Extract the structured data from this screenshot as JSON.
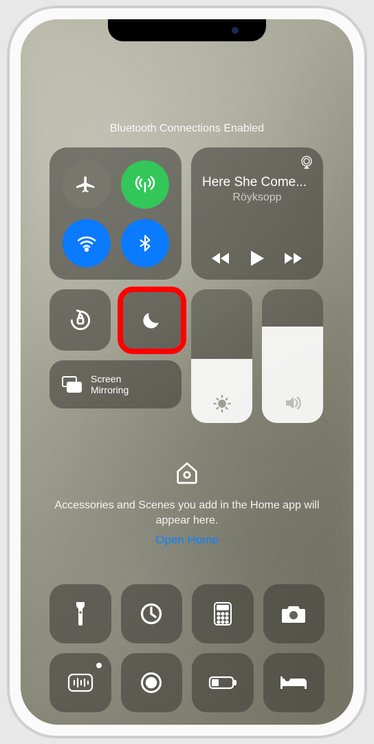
{
  "banner": "Bluetooth Connections Enabled",
  "connectivity": {
    "airplane": {
      "name": "airplane-mode",
      "active": false
    },
    "cellular": {
      "name": "cellular-data",
      "active": true
    },
    "wifi": {
      "name": "wifi",
      "active": true
    },
    "bluetooth": {
      "name": "bluetooth",
      "active": true
    }
  },
  "media": {
    "title": "Here She Come...",
    "artist": "Röyksopp"
  },
  "tiles": {
    "rotation_lock": "rotation-lock",
    "dnd": "do-not-disturb",
    "screen_mirroring_label": "Screen\nMirroring"
  },
  "sliders": {
    "brightness_pct": 48,
    "volume_pct": 72
  },
  "home": {
    "text": "Accessories and Scenes you add in the Home app will appear here.",
    "link": "Open Home"
  },
  "bottom": [
    "flashlight",
    "timer",
    "calculator",
    "camera",
    "voice-memos",
    "screen-record",
    "low-power-mode",
    "sleep"
  ]
}
